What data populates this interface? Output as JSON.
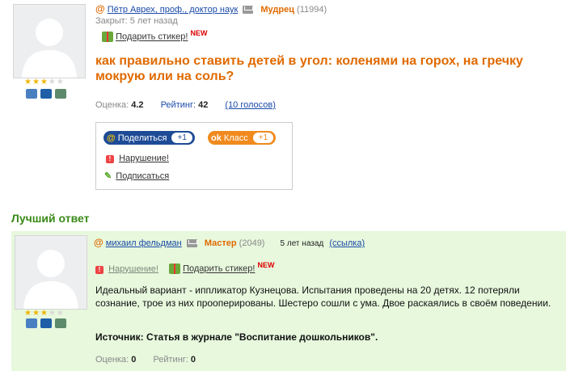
{
  "question": {
    "author": "Пётр Аврех, проф., доктор наук",
    "rank": "Мудрец",
    "points": "(11994)",
    "closed": "Закрыт: 5 лет назад",
    "sticker": "Подарить стикер!",
    "new_badge": "NEW",
    "text": "как правильно ставить детей в угол: коленями на горох, на гречку мокрую или на соль?",
    "rating_score_label": "Оценка:",
    "rating_score": "4.2",
    "rating_label": "Рейтинг:",
    "rating": "42",
    "votes": "(10 голосов)",
    "stars": 3,
    "stars_total": 5
  },
  "share": {
    "share_label": "Поделиться",
    "share_count": "+1",
    "class_label": "Класс",
    "class_count": "+1",
    "violation": "Нарушение!",
    "subscribe": "Подписаться",
    "colors": {
      "share": "#1e4b96",
      "class": "#f08a1e"
    }
  },
  "best_answer": {
    "title": "Лучший ответ",
    "author": "михаил фельдман",
    "rank": "Мастер",
    "points": "(2049)",
    "time": "5 лет назад",
    "link": "(ссылка)",
    "violation": "Нарушение!",
    "sticker": "Подарить стикер!",
    "new_badge": "NEW",
    "text": "Идеальный вариант - иппликатор Кузнецова. Испытания проведены на 20 детях. 12 потеряли сознание, трое из них прооперированы. Шестеро сошли с ума. Двое раскаялись в своём поведении.",
    "source": "Источник: Статья в журнале \"Воспитание дошкольников\".",
    "rating_score_label": "Оценка:",
    "rating_score": "0",
    "rating_label": "Рейтинг:",
    "rating": "0",
    "stars": 3,
    "stars_total": 5,
    "background": "#e7f8dd"
  }
}
